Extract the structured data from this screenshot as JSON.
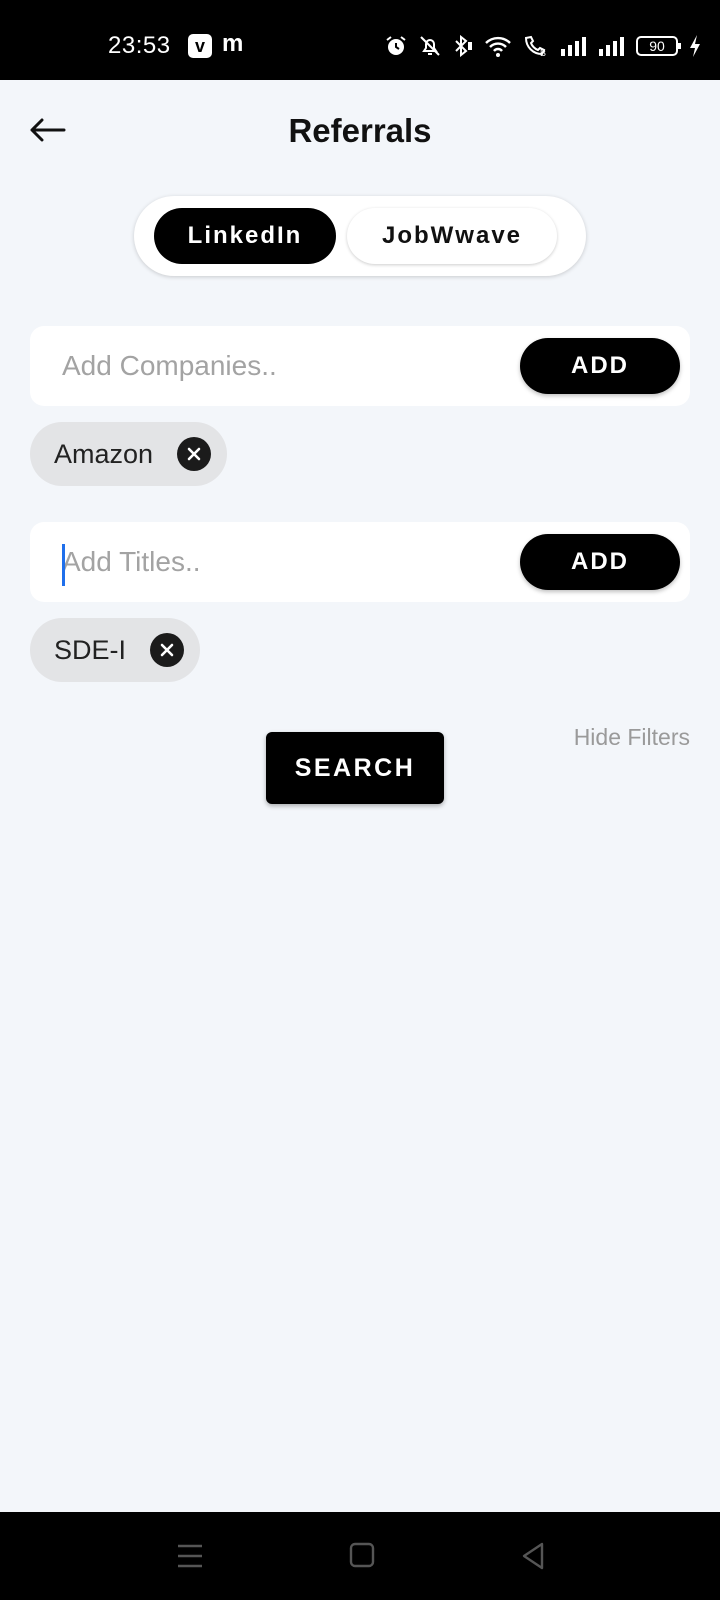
{
  "status_bar": {
    "time": "23:53",
    "app_badge": "v",
    "app_letter": "m",
    "battery": "90",
    "icons": [
      "alarm-icon",
      "bell-off-icon",
      "bluetooth-icon",
      "wifi-icon",
      "call-icon",
      "signal-icon",
      "signal-icon",
      "battery-icon",
      "charging-icon"
    ]
  },
  "header": {
    "title": "Referrals",
    "back_icon": "arrow-left-icon"
  },
  "source_toggle": {
    "options": [
      "LinkedIn",
      "JobWwave"
    ],
    "selected": "LinkedIn"
  },
  "companies": {
    "placeholder": "Add Companies..",
    "value": "",
    "add_label": "ADD",
    "chips": [
      "Amazon"
    ]
  },
  "titles": {
    "placeholder": "Add Titles..",
    "value": "",
    "add_label": "ADD",
    "chips": [
      "SDE-I"
    ]
  },
  "filters": {
    "hide_label": "Hide Filters"
  },
  "search_label": "SEARCH",
  "nav_bar": {
    "icons": [
      "menu-icon",
      "home-icon",
      "back-triangle-icon"
    ]
  },
  "colors": {
    "background": "#f3f6fa",
    "primary": "#000000",
    "chip_bg": "#e3e4e6",
    "caret": "#1f6feb",
    "muted_text": "#9a9a9a"
  }
}
